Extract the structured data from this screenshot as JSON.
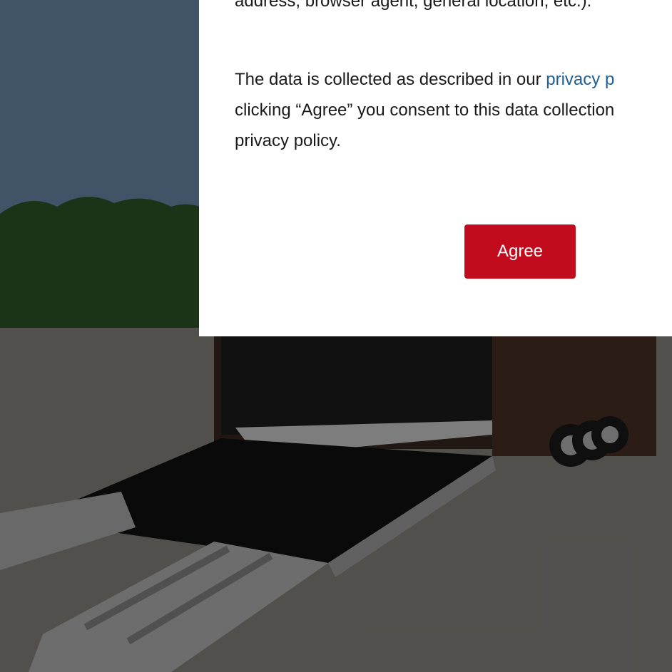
{
  "consent": {
    "partial_text": "address, browser agent, general location, etc.).",
    "privacy_prefix": "The data is collected as described in our ",
    "privacy_link": "privacy p",
    "privacy_suffix": "clicking “Agree” you consent to this data collection\nprivacy policy.",
    "agree_label": "Agree"
  },
  "background": {
    "description_icon": "trailer-photo",
    "overlay_color": "#000000"
  },
  "colors": {
    "agree_button": "#c20b1d",
    "link": "#1f5f94"
  }
}
